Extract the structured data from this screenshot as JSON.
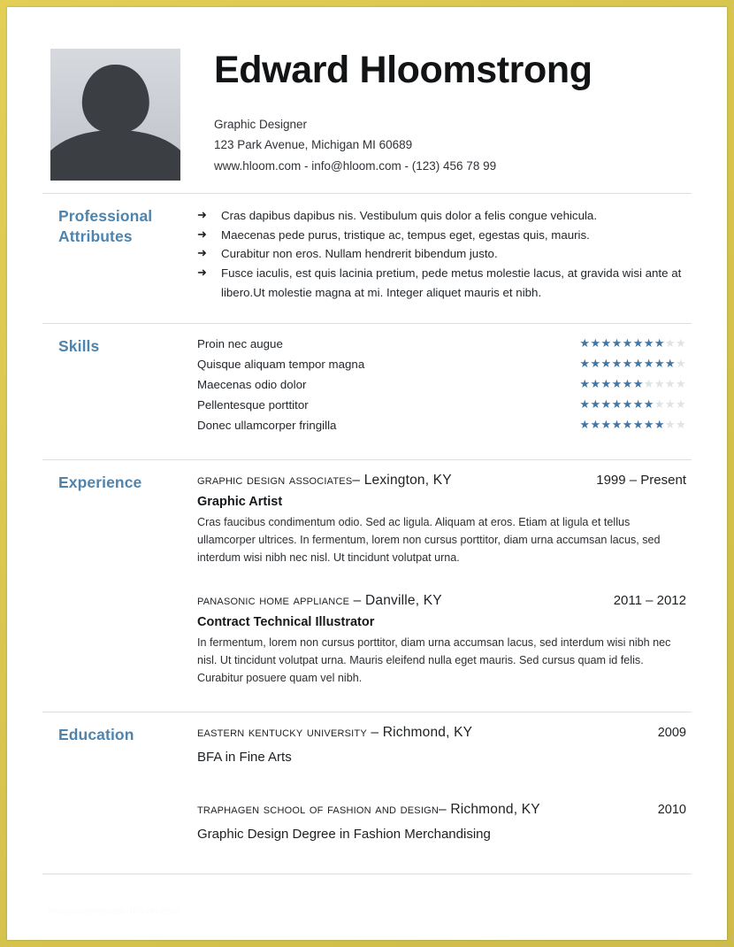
{
  "document": {
    "type": "resume",
    "watermark": "resume-template-hloom.com"
  },
  "header": {
    "name": "Edward Hloomstrong",
    "title": "Graphic Designer",
    "address": "123 Park Avenue, Michigan MI 60689",
    "contact_line": "www.hloom.com - info@hloom.com - (123) 456 78 99",
    "photo_alt": "placeholder-portrait"
  },
  "sections": {
    "attributes": {
      "label_line1": "Professional",
      "label_line2": "Attributes",
      "bullet_glyph": "➜",
      "items": [
        "Cras dapibus dapibus nis. Vestibulum quis dolor a felis congue vehicula.",
        "Maecenas pede purus, tristique ac, tempus eget, egestas quis, mauris.",
        "Curabitur non eros. Nullam hendrerit bibendum justo.",
        "Fusce iaculis, est quis lacinia pretium, pede metus molestie lacus, at gravida wisi ante at libero.Ut molestie magna at mi. Integer aliquet mauris et nibh."
      ]
    },
    "skills": {
      "label": "Skills",
      "max_stars": 10,
      "items": [
        {
          "name": "Proin nec augue",
          "rating": 8
        },
        {
          "name": "Quisque aliquam tempor magna",
          "rating": 9
        },
        {
          "name": "Maecenas odio dolor",
          "rating": 6
        },
        {
          "name": "Pellentesque porttitor",
          "rating": 7
        },
        {
          "name": "Donec ullamcorper fringilla",
          "rating": 8
        }
      ]
    },
    "experience": {
      "label": "Experience",
      "entries": [
        {
          "organization": "Graphic Design Associates",
          "location": "– Lexington, KY",
          "dates": "1999 – Present",
          "role": "Graphic Artist",
          "description": "Cras faucibus condimentum odio. Sed ac ligula. Aliquam at eros. Etiam at ligula et tellus ullamcorper ultrices. In fermentum, lorem non cursus porttitor, diam urna accumsan lacus, sed interdum wisi nibh nec nisl. Ut tincidunt volutpat urna."
        },
        {
          "organization": "Panasonic Home Appliance",
          "location": " – Danville, KY",
          "dates": "2011 – 2012",
          "role": "Contract Technical Illustrator",
          "description": "In fermentum, lorem non cursus porttitor, diam urna accumsan lacus, sed interdum wisi nibh nec nisl. Ut tincidunt volutpat urna. Mauris eleifend nulla eget mauris. Sed cursus quam id felis. Curabitur posuere quam vel nibh."
        }
      ]
    },
    "education": {
      "label": "Education",
      "entries": [
        {
          "organization": "Eastern Kentucky University",
          "location": " – Richmond, KY",
          "dates": "2009",
          "degree": "BFA in Fine Arts"
        },
        {
          "organization": "Traphagen School of Fashion and Design",
          "location": "– Richmond, KY",
          "dates": "2010",
          "degree": "Graphic Design Degree in Fashion Merchandising"
        }
      ]
    }
  },
  "colors": {
    "accent_heading": "#4e84ad",
    "star_filled": "#3f76a8",
    "star_empty": "#dfe3e7",
    "divider": "#dcdfe2",
    "border_frame": "#d8c64f",
    "body_text": "#23272b"
  }
}
